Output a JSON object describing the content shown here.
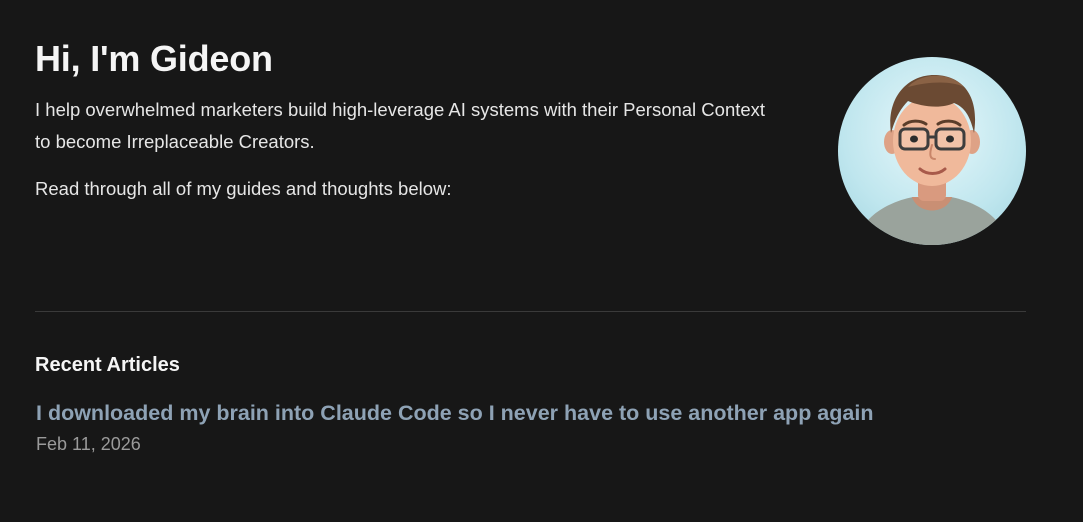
{
  "intro": {
    "title": "Hi, I'm Gideon",
    "bio_line1": "I help overwhelmed marketers build high-leverage AI systems with their Personal Context",
    "bio_line2": "to become Irreplaceable Creators.",
    "prompt": "Read through all of my guides and thoughts below:"
  },
  "avatar": {
    "icon": "avatar-illustration",
    "background_color": "#cdeef3",
    "shirt_color": "#9aa39c",
    "hair_color": "#6b4a33"
  },
  "recent_articles": {
    "heading": "Recent Articles",
    "items": [
      {
        "title": "I downloaded my brain into Claude Code so I never have to use another app again",
        "date": "Feb 11, 2026"
      }
    ]
  },
  "colors": {
    "background": "#171717",
    "text": "#f2f2f2",
    "link": "#8ea2b5",
    "muted": "#9a9a9a",
    "divider": "#3a3a3a"
  }
}
